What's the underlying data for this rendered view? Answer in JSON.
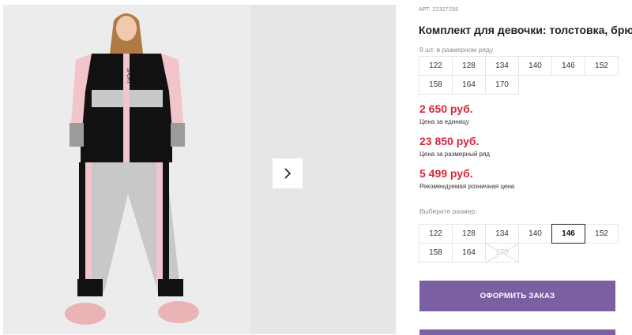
{
  "product": {
    "article": "АРТ. 22327258",
    "title": "Комплект для девочки: толстовка, брюки"
  },
  "size_row": {
    "note": "9 шт. в размерном ряду",
    "sizes": [
      "122",
      "128",
      "134",
      "140",
      "146",
      "152",
      "158",
      "164",
      "170"
    ]
  },
  "prices": {
    "unit_price": "2 650 руб.",
    "unit_note": "Цена за единицу",
    "row_price": "23 850 руб.",
    "row_note": "Цена за размерный ряд",
    "retail_price": "5 499 руб.",
    "retail_note": "Рекомендуемая розничная цена"
  },
  "size_select": {
    "label": "Выберите размер:",
    "sizes": [
      "122",
      "128",
      "134",
      "140",
      "146",
      "152",
      "158",
      "164",
      "170"
    ],
    "selected": "146",
    "unavailable": [
      "170"
    ]
  },
  "actions": {
    "order_label": "ОФОРМИТЬ ЗАКАЗ"
  },
  "gallery": {
    "next_icon": "chevron-right-icon",
    "print_text": "SPORT"
  },
  "colors": {
    "accent_button": "#7a5fa3",
    "price_red": "#d7263d"
  }
}
